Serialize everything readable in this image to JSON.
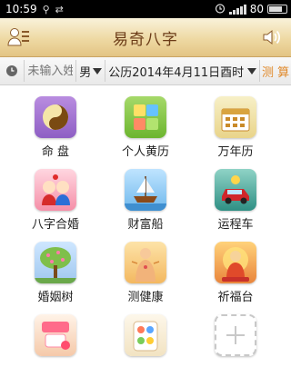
{
  "status_bar": {
    "time": "10:59",
    "battery": "80",
    "battery_level": 0.8
  },
  "app": {
    "title": "易奇八字"
  },
  "input_bar": {
    "name_placeholder": "未输入姓",
    "gender": "男",
    "date": "公历2014年4月11日酉时",
    "calculate_label": "测 算"
  },
  "grid": {
    "items": [
      {
        "label": "命 盘",
        "icon": "yin-yang-icon"
      },
      {
        "label": "个人黄历",
        "icon": "almanac-icon"
      },
      {
        "label": "万年历",
        "icon": "calendar-icon"
      },
      {
        "label": "八字合婚",
        "icon": "couple-icon"
      },
      {
        "label": "财富船",
        "icon": "ship-icon"
      },
      {
        "label": "运程车",
        "icon": "car-icon"
      },
      {
        "label": "婚姻树",
        "icon": "tree-icon"
      },
      {
        "label": "测健康",
        "icon": "health-icon"
      },
      {
        "label": "祈福台",
        "icon": "buddha-icon"
      },
      {
        "label": "",
        "icon": "app-icon"
      },
      {
        "label": "",
        "icon": "app-icon"
      },
      {
        "label": "",
        "icon": "add-icon"
      }
    ]
  }
}
